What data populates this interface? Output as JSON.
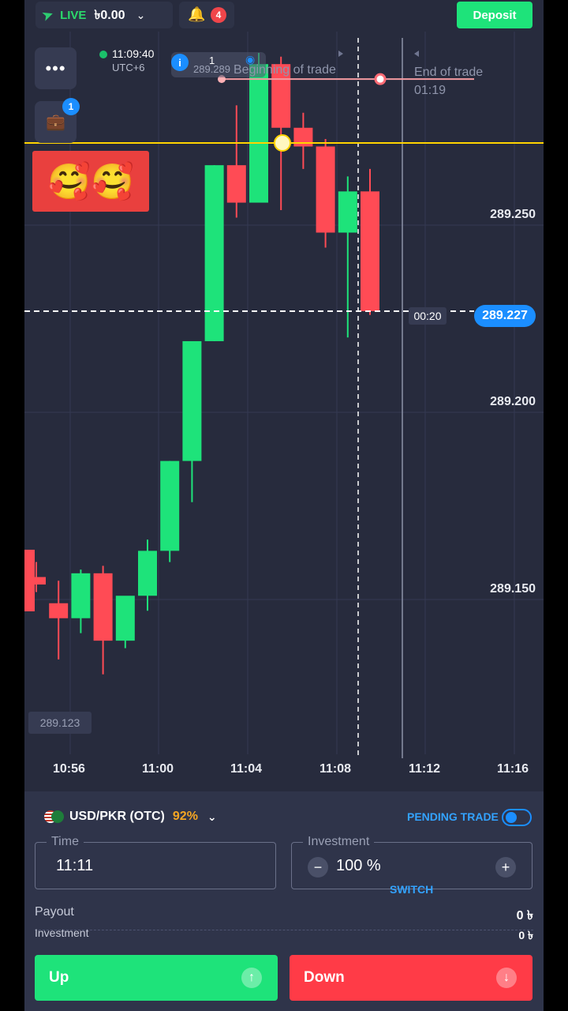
{
  "header": {
    "mode_label": "LIVE",
    "balance": "৳0.00",
    "notifications_count": "4",
    "deposit_label": "Deposit"
  },
  "toolbar": {
    "menu_label": "•••",
    "portfolio_badge": "1"
  },
  "clock": {
    "time": "11:09:40",
    "timezone": "UTC+6"
  },
  "trade_info": {
    "count": "1",
    "open_price": "289.289"
  },
  "chart_labels": {
    "beginning_of_trade": "Beginning of trade",
    "end_of_trade": "End of trade",
    "end_countdown": "01:19",
    "current_price": "289.227",
    "current_timer": "00:20",
    "min_price": "289.123"
  },
  "emoji_card": "🥰🥰",
  "chart_data": {
    "type": "candlestick",
    "y_ticks": [
      "289.250",
      "289.200",
      "289.150"
    ],
    "x_ticks": [
      "10:56",
      "11:00",
      "11:04",
      "11:08",
      "11:12",
      "11:16"
    ],
    "current_price": 289.227,
    "trade_open_price": 289.289,
    "candles": [
      {
        "o": 289.156,
        "h": 289.16,
        "l": 289.152,
        "c": 289.154
      },
      {
        "o": 289.149,
        "h": 289.155,
        "l": 289.134,
        "c": 289.145
      },
      {
        "o": 289.145,
        "h": 289.158,
        "l": 289.141,
        "c": 289.157
      },
      {
        "o": 289.157,
        "h": 289.159,
        "l": 289.13,
        "c": 289.139
      },
      {
        "o": 289.139,
        "h": 289.15,
        "l": 289.137,
        "c": 289.151
      },
      {
        "o": 289.151,
        "h": 289.166,
        "l": 289.147,
        "c": 289.163
      },
      {
        "o": 289.163,
        "h": 289.187,
        "l": 289.16,
        "c": 289.187
      },
      {
        "o": 289.187,
        "h": 289.219,
        "l": 289.176,
        "c": 289.219
      },
      {
        "o": 289.219,
        "h": 289.266,
        "l": 289.219,
        "c": 289.266
      },
      {
        "o": 289.266,
        "h": 289.282,
        "l": 289.252,
        "c": 289.256
      },
      {
        "o": 289.256,
        "h": 289.296,
        "l": 289.256,
        "c": 289.293
      },
      {
        "o": 289.293,
        "h": 289.295,
        "l": 289.254,
        "c": 289.276
      },
      {
        "o": 289.276,
        "h": 289.28,
        "l": 289.265,
        "c": 289.271
      },
      {
        "o": 289.271,
        "h": 289.273,
        "l": 289.244,
        "c": 289.248
      },
      {
        "o": 289.248,
        "h": 289.263,
        "l": 289.22,
        "c": 289.259
      },
      {
        "o": 289.259,
        "h": 289.265,
        "l": 289.226,
        "c": 289.227
      }
    ]
  },
  "panel": {
    "pair": "USD/PKR (OTC)",
    "payout_pct": "92%",
    "pending_label": "PENDING TRADE",
    "time_label": "Time",
    "time_value": "11:11",
    "investment_label": "Investment",
    "investment_value": "100 %",
    "switch_label": "SWITCH",
    "payout_label": "Payout",
    "payout_value": "0 ৳",
    "investment_row_label": "Investment",
    "investment_row_value": "0 ৳",
    "up_label": "Up",
    "down_label": "Down"
  },
  "colors": {
    "up": "#1ee37a",
    "down": "#ff4b55",
    "accent": "#1b8eff",
    "background": "#272b3d"
  }
}
